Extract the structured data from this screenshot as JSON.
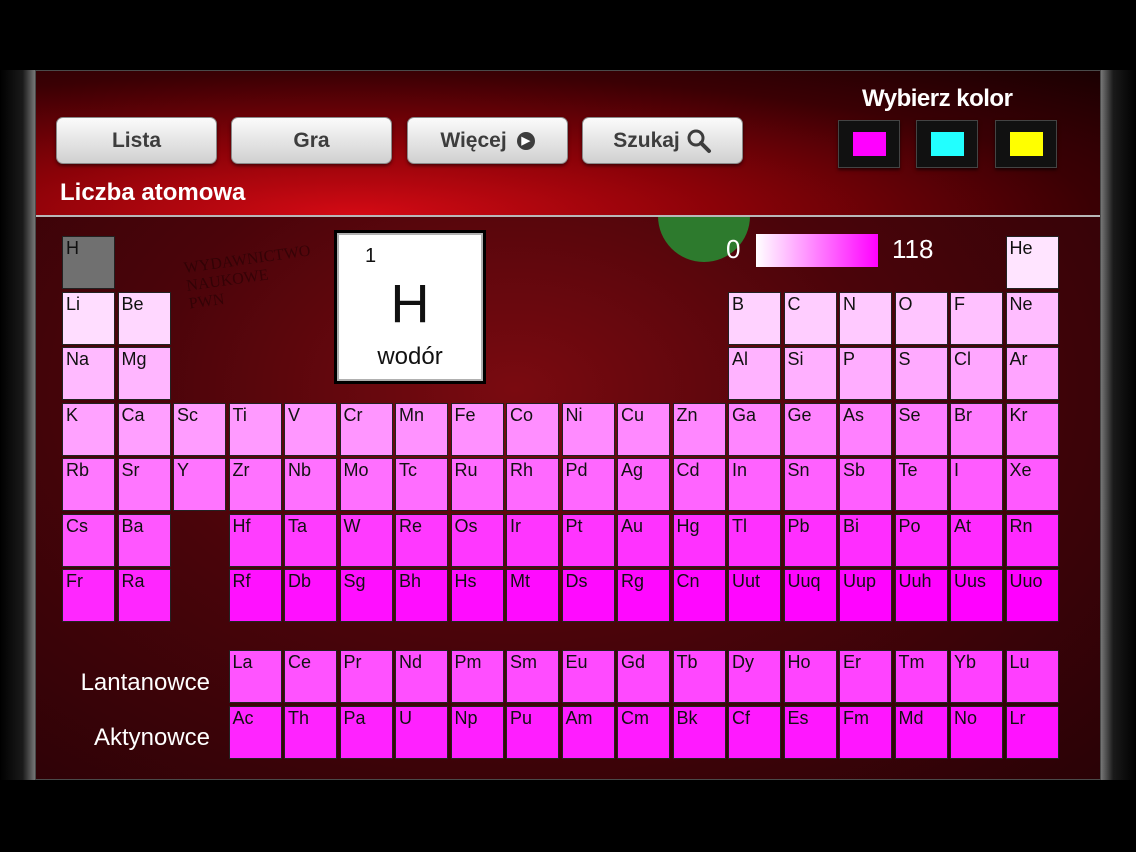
{
  "toolbar": {
    "list_label": "Lista",
    "game_label": "Gra",
    "more_label": "Więcej",
    "search_label": "Szukaj"
  },
  "page_title": "Liczba atomowa",
  "color_picker": {
    "title": "Wybierz kolor",
    "options": [
      {
        "name": "magenta",
        "color": "#ff00ff"
      },
      {
        "name": "cyan",
        "color": "#22ffff"
      },
      {
        "name": "yellow",
        "color": "#ffff00"
      }
    ]
  },
  "selected_element": {
    "number": "1",
    "symbol": "H",
    "name": "wodór"
  },
  "legend": {
    "min": "0",
    "max": "118",
    "from_color": "#ffffff",
    "to_color": "#ff00ff"
  },
  "series_labels": {
    "lanthanides": "Lantanowce",
    "actinides": "Aktynowce"
  },
  "watermark": [
    "WYDAWNICTWO",
    "NAUKOWE",
    "PWN"
  ],
  "selected_color": "#707070",
  "elements": [
    {
      "symbol": "H",
      "number": 1,
      "period": 1,
      "group": 1,
      "selected": true
    },
    {
      "symbol": "He",
      "number": 2,
      "period": 1,
      "group": 18
    },
    {
      "symbol": "Li",
      "number": 3,
      "period": 2,
      "group": 1
    },
    {
      "symbol": "Be",
      "number": 4,
      "period": 2,
      "group": 2
    },
    {
      "symbol": "B",
      "number": 5,
      "period": 2,
      "group": 13
    },
    {
      "symbol": "C",
      "number": 6,
      "period": 2,
      "group": 14
    },
    {
      "symbol": "N",
      "number": 7,
      "period": 2,
      "group": 15
    },
    {
      "symbol": "O",
      "number": 8,
      "period": 2,
      "group": 16
    },
    {
      "symbol": "F",
      "number": 9,
      "period": 2,
      "group": 17
    },
    {
      "symbol": "Ne",
      "number": 10,
      "period": 2,
      "group": 18
    },
    {
      "symbol": "Na",
      "number": 11,
      "period": 3,
      "group": 1
    },
    {
      "symbol": "Mg",
      "number": 12,
      "period": 3,
      "group": 2
    },
    {
      "symbol": "Al",
      "number": 13,
      "period": 3,
      "group": 13
    },
    {
      "symbol": "Si",
      "number": 14,
      "period": 3,
      "group": 14
    },
    {
      "symbol": "P",
      "number": 15,
      "period": 3,
      "group": 15
    },
    {
      "symbol": "S",
      "number": 16,
      "period": 3,
      "group": 16
    },
    {
      "symbol": "Cl",
      "number": 17,
      "period": 3,
      "group": 17
    },
    {
      "symbol": "Ar",
      "number": 18,
      "period": 3,
      "group": 18
    },
    {
      "symbol": "K",
      "number": 19,
      "period": 4,
      "group": 1
    },
    {
      "symbol": "Ca",
      "number": 20,
      "period": 4,
      "group": 2
    },
    {
      "symbol": "Sc",
      "number": 21,
      "period": 4,
      "group": 3
    },
    {
      "symbol": "Ti",
      "number": 22,
      "period": 4,
      "group": 4
    },
    {
      "symbol": "V",
      "number": 23,
      "period": 4,
      "group": 5
    },
    {
      "symbol": "Cr",
      "number": 24,
      "period": 4,
      "group": 6
    },
    {
      "symbol": "Mn",
      "number": 25,
      "period": 4,
      "group": 7
    },
    {
      "symbol": "Fe",
      "number": 26,
      "period": 4,
      "group": 8
    },
    {
      "symbol": "Co",
      "number": 27,
      "period": 4,
      "group": 9
    },
    {
      "symbol": "Ni",
      "number": 28,
      "period": 4,
      "group": 10
    },
    {
      "symbol": "Cu",
      "number": 29,
      "period": 4,
      "group": 11
    },
    {
      "symbol": "Zn",
      "number": 30,
      "period": 4,
      "group": 12
    },
    {
      "symbol": "Ga",
      "number": 31,
      "period": 4,
      "group": 13
    },
    {
      "symbol": "Ge",
      "number": 32,
      "period": 4,
      "group": 14
    },
    {
      "symbol": "As",
      "number": 33,
      "period": 4,
      "group": 15
    },
    {
      "symbol": "Se",
      "number": 34,
      "period": 4,
      "group": 16
    },
    {
      "symbol": "Br",
      "number": 35,
      "period": 4,
      "group": 17
    },
    {
      "symbol": "Kr",
      "number": 36,
      "period": 4,
      "group": 18
    },
    {
      "symbol": "Rb",
      "number": 37,
      "period": 5,
      "group": 1
    },
    {
      "symbol": "Sr",
      "number": 38,
      "period": 5,
      "group": 2
    },
    {
      "symbol": "Y",
      "number": 39,
      "period": 5,
      "group": 3
    },
    {
      "symbol": "Zr",
      "number": 40,
      "period": 5,
      "group": 4
    },
    {
      "symbol": "Nb",
      "number": 41,
      "period": 5,
      "group": 5
    },
    {
      "symbol": "Mo",
      "number": 42,
      "period": 5,
      "group": 6
    },
    {
      "symbol": "Tc",
      "number": 43,
      "period": 5,
      "group": 7
    },
    {
      "symbol": "Ru",
      "number": 44,
      "period": 5,
      "group": 8
    },
    {
      "symbol": "Rh",
      "number": 45,
      "period": 5,
      "group": 9
    },
    {
      "symbol": "Pd",
      "number": 46,
      "period": 5,
      "group": 10
    },
    {
      "symbol": "Ag",
      "number": 47,
      "period": 5,
      "group": 11
    },
    {
      "symbol": "Cd",
      "number": 48,
      "period": 5,
      "group": 12
    },
    {
      "symbol": "In",
      "number": 49,
      "period": 5,
      "group": 13
    },
    {
      "symbol": "Sn",
      "number": 50,
      "period": 5,
      "group": 14
    },
    {
      "symbol": "Sb",
      "number": 51,
      "period": 5,
      "group": 15
    },
    {
      "symbol": "Te",
      "number": 52,
      "period": 5,
      "group": 16
    },
    {
      "symbol": "I",
      "number": 53,
      "period": 5,
      "group": 17
    },
    {
      "symbol": "Xe",
      "number": 54,
      "period": 5,
      "group": 18
    },
    {
      "symbol": "Cs",
      "number": 55,
      "period": 6,
      "group": 1
    },
    {
      "symbol": "Ba",
      "number": 56,
      "period": 6,
      "group": 2
    },
    {
      "symbol": "Hf",
      "number": 72,
      "period": 6,
      "group": 4
    },
    {
      "symbol": "Ta",
      "number": 73,
      "period": 6,
      "group": 5
    },
    {
      "symbol": "W",
      "number": 74,
      "period": 6,
      "group": 6
    },
    {
      "symbol": "Re",
      "number": 75,
      "period": 6,
      "group": 7
    },
    {
      "symbol": "Os",
      "number": 76,
      "period": 6,
      "group": 8
    },
    {
      "symbol": "Ir",
      "number": 77,
      "period": 6,
      "group": 9
    },
    {
      "symbol": "Pt",
      "number": 78,
      "period": 6,
      "group": 10
    },
    {
      "symbol": "Au",
      "number": 79,
      "period": 6,
      "group": 11
    },
    {
      "symbol": "Hg",
      "number": 80,
      "period": 6,
      "group": 12
    },
    {
      "symbol": "Tl",
      "number": 81,
      "period": 6,
      "group": 13
    },
    {
      "symbol": "Pb",
      "number": 82,
      "period": 6,
      "group": 14
    },
    {
      "symbol": "Bi",
      "number": 83,
      "period": 6,
      "group": 15
    },
    {
      "symbol": "Po",
      "number": 84,
      "period": 6,
      "group": 16
    },
    {
      "symbol": "At",
      "number": 85,
      "period": 6,
      "group": 17
    },
    {
      "symbol": "Rn",
      "number": 86,
      "period": 6,
      "group": 18
    },
    {
      "symbol": "Fr",
      "number": 87,
      "period": 7,
      "group": 1
    },
    {
      "symbol": "Ra",
      "number": 88,
      "period": 7,
      "group": 2
    },
    {
      "symbol": "Rf",
      "number": 104,
      "period": 7,
      "group": 4
    },
    {
      "symbol": "Db",
      "number": 105,
      "period": 7,
      "group": 5
    },
    {
      "symbol": "Sg",
      "number": 106,
      "period": 7,
      "group": 6
    },
    {
      "symbol": "Bh",
      "number": 107,
      "period": 7,
      "group": 7
    },
    {
      "symbol": "Hs",
      "number": 108,
      "period": 7,
      "group": 8
    },
    {
      "symbol": "Mt",
      "number": 109,
      "period": 7,
      "group": 9
    },
    {
      "symbol": "Ds",
      "number": 110,
      "period": 7,
      "group": 10
    },
    {
      "symbol": "Rg",
      "number": 111,
      "period": 7,
      "group": 11
    },
    {
      "symbol": "Cn",
      "number": 112,
      "period": 7,
      "group": 12
    },
    {
      "symbol": "Uut",
      "number": 113,
      "period": 7,
      "group": 13
    },
    {
      "symbol": "Uuq",
      "number": 114,
      "period": 7,
      "group": 14
    },
    {
      "symbol": "Uup",
      "number": 115,
      "period": 7,
      "group": 15
    },
    {
      "symbol": "Uuh",
      "number": 116,
      "period": 7,
      "group": 16
    },
    {
      "symbol": "Uus",
      "number": 117,
      "period": 7,
      "group": 17
    },
    {
      "symbol": "Uuo",
      "number": 118,
      "period": 7,
      "group": 18
    },
    {
      "symbol": "La",
      "number": 57,
      "series": "lanthanide",
      "index": 0
    },
    {
      "symbol": "Ce",
      "number": 58,
      "series": "lanthanide",
      "index": 1
    },
    {
      "symbol": "Pr",
      "number": 59,
      "series": "lanthanide",
      "index": 2
    },
    {
      "symbol": "Nd",
      "number": 60,
      "series": "lanthanide",
      "index": 3
    },
    {
      "symbol": "Pm",
      "number": 61,
      "series": "lanthanide",
      "index": 4
    },
    {
      "symbol": "Sm",
      "number": 62,
      "series": "lanthanide",
      "index": 5
    },
    {
      "symbol": "Eu",
      "number": 63,
      "series": "lanthanide",
      "index": 6
    },
    {
      "symbol": "Gd",
      "number": 64,
      "series": "lanthanide",
      "index": 7
    },
    {
      "symbol": "Tb",
      "number": 65,
      "series": "lanthanide",
      "index": 8
    },
    {
      "symbol": "Dy",
      "number": 66,
      "series": "lanthanide",
      "index": 9
    },
    {
      "symbol": "Ho",
      "number": 67,
      "series": "lanthanide",
      "index": 10
    },
    {
      "symbol": "Er",
      "number": 68,
      "series": "lanthanide",
      "index": 11
    },
    {
      "symbol": "Tm",
      "number": 69,
      "series": "lanthanide",
      "index": 12
    },
    {
      "symbol": "Yb",
      "number": 70,
      "series": "lanthanide",
      "index": 13
    },
    {
      "symbol": "Lu",
      "number": 71,
      "series": "lanthanide",
      "index": 14
    },
    {
      "symbol": "Ac",
      "number": 89,
      "series": "actinide",
      "index": 0
    },
    {
      "symbol": "Th",
      "number": 90,
      "series": "actinide",
      "index": 1
    },
    {
      "symbol": "Pa",
      "number": 91,
      "series": "actinide",
      "index": 2
    },
    {
      "symbol": "U",
      "number": 92,
      "series": "actinide",
      "index": 3
    },
    {
      "symbol": "Np",
      "number": 93,
      "series": "actinide",
      "index": 4
    },
    {
      "symbol": "Pu",
      "number": 94,
      "series": "actinide",
      "index": 5
    },
    {
      "symbol": "Am",
      "number": 95,
      "series": "actinide",
      "index": 6
    },
    {
      "symbol": "Cm",
      "number": 96,
      "series": "actinide",
      "index": 7
    },
    {
      "symbol": "Bk",
      "number": 97,
      "series": "actinide",
      "index": 8
    },
    {
      "symbol": "Cf",
      "number": 98,
      "series": "actinide",
      "index": 9
    },
    {
      "symbol": "Es",
      "number": 99,
      "series": "actinide",
      "index": 10
    },
    {
      "symbol": "Fm",
      "number": 100,
      "series": "actinide",
      "index": 11
    },
    {
      "symbol": "Md",
      "number": 101,
      "series": "actinide",
      "index": 12
    },
    {
      "symbol": "No",
      "number": 102,
      "series": "actinide",
      "index": 13
    },
    {
      "symbol": "Lr",
      "number": 103,
      "series": "actinide",
      "index": 14
    }
  ]
}
